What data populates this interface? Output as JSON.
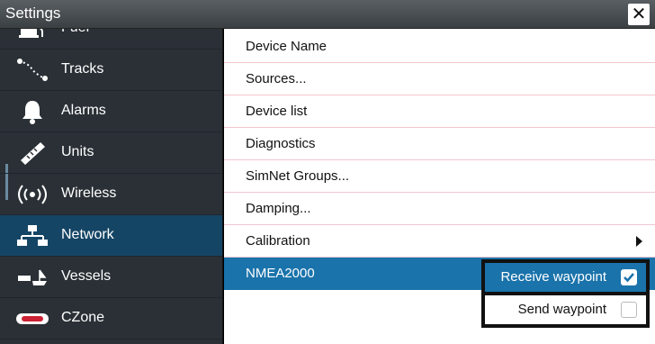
{
  "window": {
    "title": "Settings",
    "close_label": "✕"
  },
  "sidebar": {
    "items": [
      {
        "label": "Fuel",
        "icon": "fuel-icon"
      },
      {
        "label": "Tracks",
        "icon": "tracks-icon"
      },
      {
        "label": "Alarms",
        "icon": "bell-icon"
      },
      {
        "label": "Units",
        "icon": "ruler-icon"
      },
      {
        "label": "Wireless",
        "icon": "wireless-icon"
      },
      {
        "label": "Network",
        "icon": "network-icon",
        "selected": true
      },
      {
        "label": "Vessels",
        "icon": "vessels-icon"
      },
      {
        "label": "CZone",
        "icon": "czone-icon"
      }
    ]
  },
  "main": {
    "rows": [
      {
        "label": "Device Name"
      },
      {
        "label": "Sources..."
      },
      {
        "label": "Device list"
      },
      {
        "label": "Diagnostics"
      },
      {
        "label": "SimNet Groups..."
      },
      {
        "label": "Damping..."
      },
      {
        "label": "Calibration",
        "submenu": true
      },
      {
        "label": "NMEA2000",
        "selected": true
      }
    ]
  },
  "popup": {
    "items": [
      {
        "label": "Receive waypoint",
        "checked": true
      },
      {
        "label": "Send waypoint",
        "checked": false
      }
    ]
  },
  "colors": {
    "selected_blue": "#1a73ab",
    "sidebar_bg": "#2a3036",
    "sidebar_selected": "#154565",
    "row_divider": "#f2c6cf"
  }
}
